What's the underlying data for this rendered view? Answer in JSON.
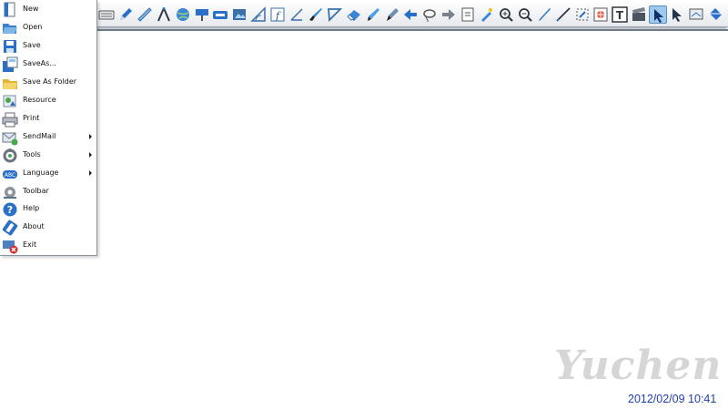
{
  "menu": {
    "items": [
      {
        "label": "New",
        "icon": "new-document-icon",
        "submenu": false
      },
      {
        "label": "Open",
        "icon": "open-folder-icon",
        "submenu": false
      },
      {
        "label": "Save",
        "icon": "save-disk-icon",
        "submenu": false
      },
      {
        "label": "SaveAs...",
        "icon": "save-as-icon",
        "submenu": false
      },
      {
        "label": "Save As Folder",
        "icon": "save-as-folder-icon",
        "submenu": false
      },
      {
        "label": "Resource",
        "icon": "resource-icon",
        "submenu": false
      },
      {
        "label": "Print",
        "icon": "printer-icon",
        "submenu": false
      },
      {
        "label": "SendMail",
        "icon": "send-mail-icon",
        "submenu": true
      },
      {
        "label": "Tools",
        "icon": "tools-icon",
        "submenu": true
      },
      {
        "label": "Language",
        "icon": "language-icon",
        "submenu": true
      },
      {
        "label": "Toolbar",
        "icon": "toolbar-gear-icon",
        "submenu": false
      },
      {
        "label": "Help",
        "icon": "help-icon",
        "submenu": false
      },
      {
        "label": "About",
        "icon": "about-icon",
        "submenu": false
      },
      {
        "label": "Exit",
        "icon": "exit-icon",
        "submenu": false
      }
    ]
  },
  "toolbar": {
    "tools": [
      {
        "name": "keyboard-icon",
        "active": false
      },
      {
        "name": "pen-icon",
        "active": false
      },
      {
        "name": "ruler-icon",
        "active": false
      },
      {
        "name": "compass-icon",
        "active": false
      },
      {
        "name": "globe-icon",
        "active": false
      },
      {
        "name": "spotlight-icon",
        "active": false
      },
      {
        "name": "screen-shade-icon",
        "active": false
      },
      {
        "name": "screenshot-icon",
        "active": false
      },
      {
        "name": "protractor-icon",
        "active": false
      },
      {
        "name": "formula-icon",
        "active": false
      },
      {
        "name": "angle-icon",
        "active": false
      },
      {
        "name": "brush-icon",
        "active": false
      },
      {
        "name": "set-square-icon",
        "active": false
      },
      {
        "name": "eraser-icon",
        "active": false
      },
      {
        "name": "highlighter-icon",
        "active": false
      },
      {
        "name": "marker-icon",
        "active": false
      },
      {
        "name": "back-arrow-icon",
        "active": false
      },
      {
        "name": "lasso-icon",
        "active": false
      },
      {
        "name": "forward-arrow-icon",
        "active": false
      },
      {
        "name": "page-icon",
        "active": false
      },
      {
        "name": "magic-pen-icon",
        "active": false
      },
      {
        "name": "zoom-in-icon",
        "active": false
      },
      {
        "name": "zoom-out-icon",
        "active": false
      },
      {
        "name": "pencil-icon",
        "active": false
      },
      {
        "name": "thin-pen-icon",
        "active": false
      },
      {
        "name": "capture-icon",
        "active": false
      },
      {
        "name": "color-picker-icon",
        "active": false
      },
      {
        "name": "text-tool-icon",
        "active": false
      },
      {
        "name": "clapper-icon",
        "active": false
      },
      {
        "name": "select-pointer-icon",
        "active": true
      },
      {
        "name": "pointer-icon",
        "active": false
      },
      {
        "name": "board-icon",
        "active": false
      },
      {
        "name": "fill-bucket-icon",
        "active": false
      }
    ],
    "accent": "#1f6fc8"
  },
  "watermark": {
    "text": "Yuchen"
  },
  "status": {
    "datetime": "2012/02/09 10:41"
  }
}
